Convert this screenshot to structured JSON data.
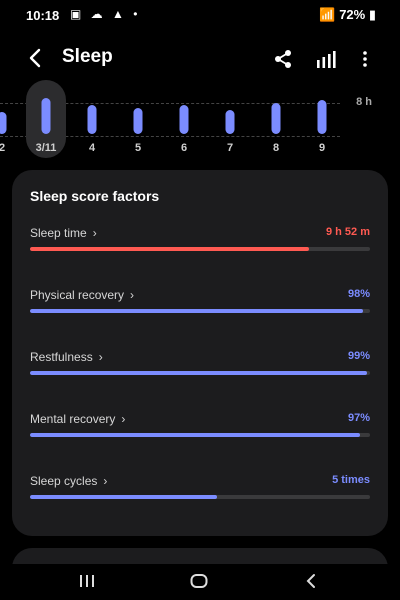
{
  "status": {
    "time": "10:18",
    "battery": "72%"
  },
  "header": {
    "title": "Sleep"
  },
  "graph": {
    "max_label": "8 h",
    "days": [
      {
        "label": "2",
        "fill": 0.45,
        "selected": false
      },
      {
        "label": "3/11",
        "fill": 0.75,
        "selected": true
      },
      {
        "label": "4",
        "fill": 0.6,
        "selected": false
      },
      {
        "label": "5",
        "fill": 0.55,
        "selected": false
      },
      {
        "label": "6",
        "fill": 0.6,
        "selected": false
      },
      {
        "label": "7",
        "fill": 0.5,
        "selected": false
      },
      {
        "label": "8",
        "fill": 0.65,
        "selected": false
      },
      {
        "label": "9",
        "fill": 0.7,
        "selected": false
      }
    ]
  },
  "factors_card": {
    "title": "Sleep score factors",
    "items": [
      {
        "label": "Sleep time",
        "value": "9 h 52 m",
        "progress": 0.82,
        "color": "#ff5a52"
      },
      {
        "label": "Physical recovery",
        "value": "98%",
        "progress": 0.98,
        "color": "#7b8cff"
      },
      {
        "label": "Restfulness",
        "value": "99%",
        "progress": 0.99,
        "color": "#7b8cff"
      },
      {
        "label": "Mental recovery",
        "value": "97%",
        "progress": 0.97,
        "color": "#7b8cff"
      },
      {
        "label": "Sleep cycles",
        "value": "5 times",
        "progress": 0.55,
        "color": "#7b8cff"
      }
    ]
  },
  "icons": {
    "back": "arrow-left-icon",
    "share": "share-icon",
    "chart": "bar-chart-icon",
    "more": "more-vertical-icon"
  },
  "colors": {
    "accent": "#7b8cff",
    "alert": "#ff5a52",
    "card": "#1c1c1e"
  }
}
